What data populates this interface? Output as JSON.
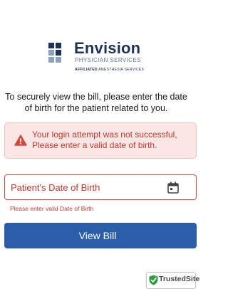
{
  "logo": {
    "brand": "Envision",
    "subtitle": "PHYSICIAN SERVICES",
    "affiliated_prefix": "AFFILIATED",
    "affiliated_suffix": "ANESTHESIA SERVICES"
  },
  "intro_text": "To securely view the bill, please enter the date of birth for the patient related to you.",
  "alert": {
    "icon": "warning-triangle-icon",
    "message": "Your login attempt was not successful, Please enter a valid date of birth."
  },
  "dob_field": {
    "placeholder": "Patient's Date of Birth",
    "value": "",
    "icon": "calendar-icon",
    "error": "Please enter valid Date of Birth"
  },
  "view_bill_button": {
    "label": "View Bill"
  },
  "trusted_badge": {
    "label": "TrustedSite",
    "icon": "check-shield-icon"
  },
  "colors": {
    "brand_navy": "#1e3356",
    "primary_button": "#2b5ea9",
    "error_red": "#c0392b",
    "alert_background": "#fbe6e6",
    "trusted_green": "#2e9e44"
  }
}
